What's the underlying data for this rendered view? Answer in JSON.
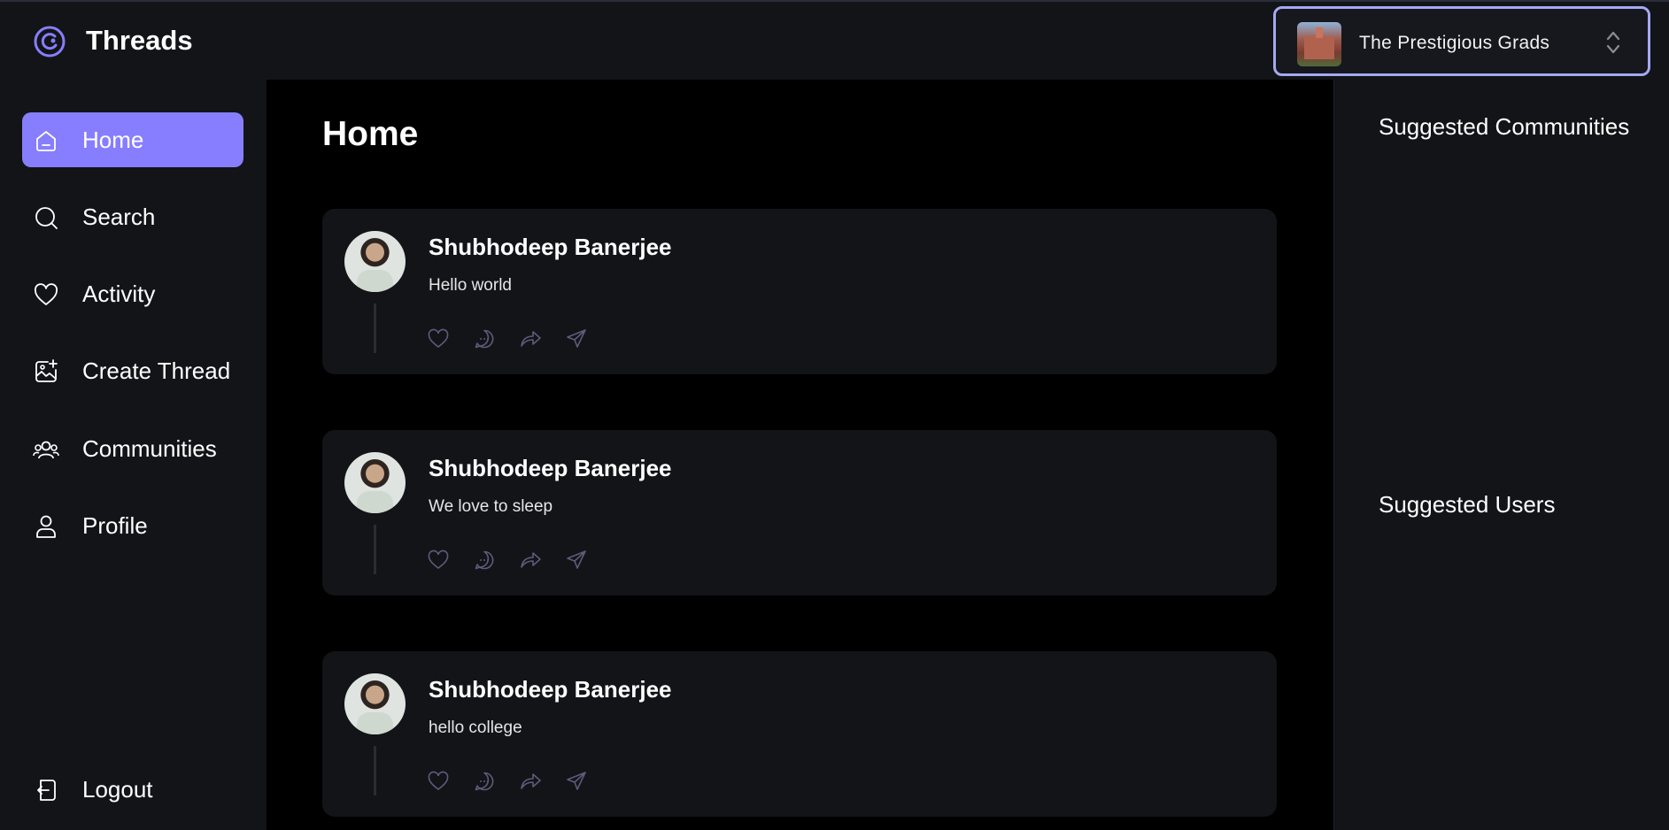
{
  "app": {
    "brand": "Threads"
  },
  "org_switcher": {
    "name": "The Prestigious Grads"
  },
  "sidebar": {
    "items": [
      {
        "label": "Home",
        "icon": "home-icon",
        "active": true
      },
      {
        "label": "Search",
        "icon": "search-icon",
        "active": false
      },
      {
        "label": "Activity",
        "icon": "heart-icon",
        "active": false
      },
      {
        "label": "Create Thread",
        "icon": "create-image-icon",
        "active": false
      },
      {
        "label": "Communities",
        "icon": "community-icon",
        "active": false
      },
      {
        "label": "Profile",
        "icon": "user-icon",
        "active": false
      }
    ],
    "logout": {
      "label": "Logout",
      "icon": "logout-icon"
    }
  },
  "main": {
    "title": "Home",
    "threads": [
      {
        "author": "Shubhodeep Banerjee",
        "text": "Hello world"
      },
      {
        "author": "Shubhodeep Banerjee",
        "text": "We love to sleep"
      },
      {
        "author": "Shubhodeep Banerjee",
        "text": "hello college"
      }
    ],
    "actions": [
      "heart-icon",
      "reply-icon",
      "repost-icon",
      "share-icon"
    ]
  },
  "rightbar": {
    "suggested_communities": "Suggested Communities",
    "suggested_users": "Suggested Users"
  },
  "colors": {
    "accent": "#877eff",
    "panel": "#121417",
    "background": "#000000",
    "switcher_border": "#a6a8f3"
  }
}
